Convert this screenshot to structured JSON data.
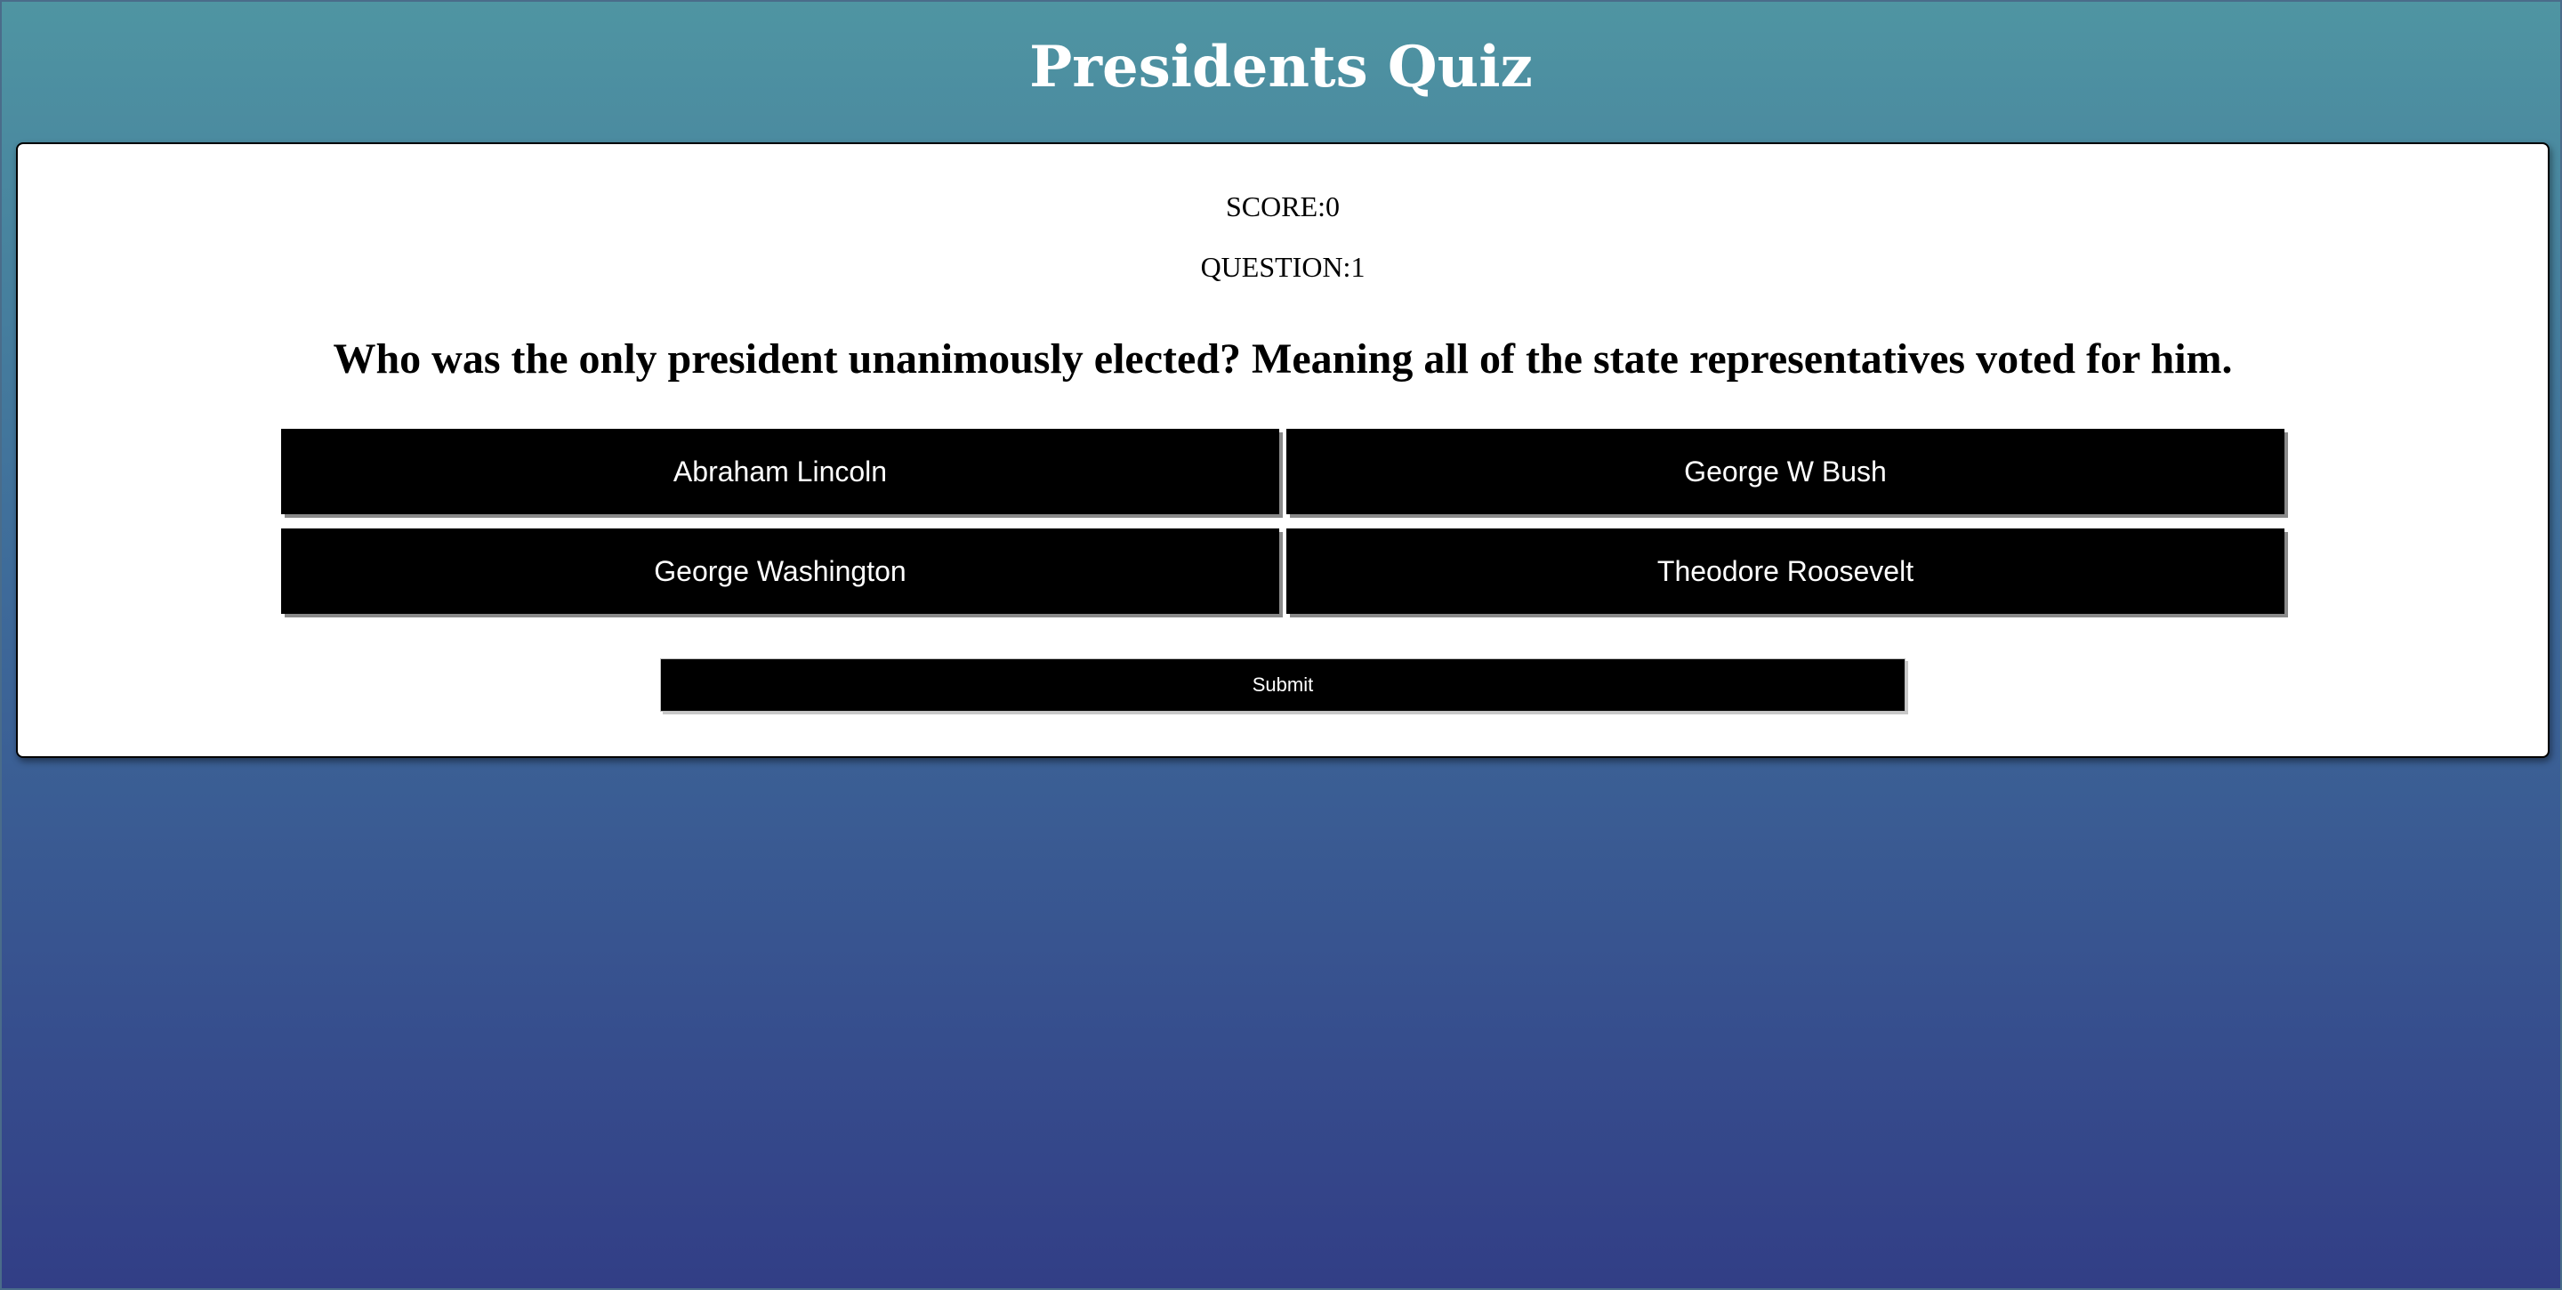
{
  "header": {
    "title": "Presidents Quiz"
  },
  "quiz": {
    "score_text": "SCORE:0",
    "question_number_text": "QUESTION:1",
    "question": "Who was the only president unanimously elected? Meaning all of the state representatives voted for him.",
    "answers": [
      {
        "label": "Abraham Lincoln"
      },
      {
        "label": "George W Bush"
      },
      {
        "label": "George Washington"
      },
      {
        "label": "Theodore Roosevelt"
      }
    ],
    "submit_label": "Submit"
  },
  "colors": {
    "background_top": "#4f95a2",
    "background_bottom": "#323e86",
    "button": "#000000",
    "button_text": "#ffffff",
    "card": "#ffffff"
  }
}
